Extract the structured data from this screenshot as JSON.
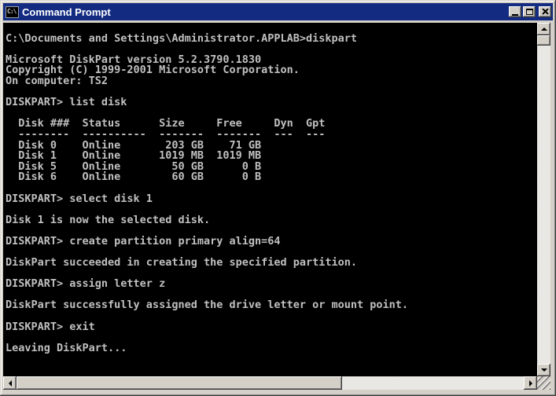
{
  "window": {
    "title": "Command Prompt",
    "icon_text": "C:\\",
    "controls": {
      "minimize": "minimize",
      "maximize": "maximize",
      "close": "close"
    }
  },
  "colors": {
    "titlebar": "#132b80",
    "title_text": "#ffffff",
    "chrome": "#d4d0c8",
    "console_background": "#000000",
    "console_text": "#c0c0c0"
  },
  "console": {
    "lines": [
      "",
      "C:\\Documents and Settings\\Administrator.APPLAB>diskpart",
      "",
      "Microsoft DiskPart version 5.2.3790.1830",
      "Copyright (C) 1999-2001 Microsoft Corporation.",
      "On computer: TS2",
      "",
      "DISKPART> list disk",
      "",
      "  Disk ###  Status      Size     Free     Dyn  Gpt",
      "  --------  ----------  -------  -------  ---  ---",
      "  Disk 0    Online       203 GB    71 GB",
      "  Disk 1    Online      1019 MB  1019 MB",
      "  Disk 5    Online        50 GB      0 B",
      "  Disk 6    Online        60 GB      0 B",
      "",
      "DISKPART> select disk 1",
      "",
      "Disk 1 is now the selected disk.",
      "",
      "DISKPART> create partition primary align=64",
      "",
      "DiskPart succeeded in creating the specified partition.",
      "",
      "DISKPART> assign letter z",
      "",
      "DiskPart successfully assigned the drive letter or mount point.",
      "",
      "DISKPART> exit",
      "",
      "Leaving DiskPart..."
    ],
    "disk_table": {
      "headers": [
        "Disk ###",
        "Status",
        "Size",
        "Free",
        "Dyn",
        "Gpt"
      ],
      "rows": [
        [
          "Disk 0",
          "Online",
          "203 GB",
          "71 GB",
          "",
          ""
        ],
        [
          "Disk 1",
          "Online",
          "1019 MB",
          "1019 MB",
          "",
          ""
        ],
        [
          "Disk 5",
          "Online",
          "50 GB",
          "0 B",
          "",
          ""
        ],
        [
          "Disk 6",
          "Online",
          "60 GB",
          "0 B",
          "",
          ""
        ]
      ]
    }
  }
}
